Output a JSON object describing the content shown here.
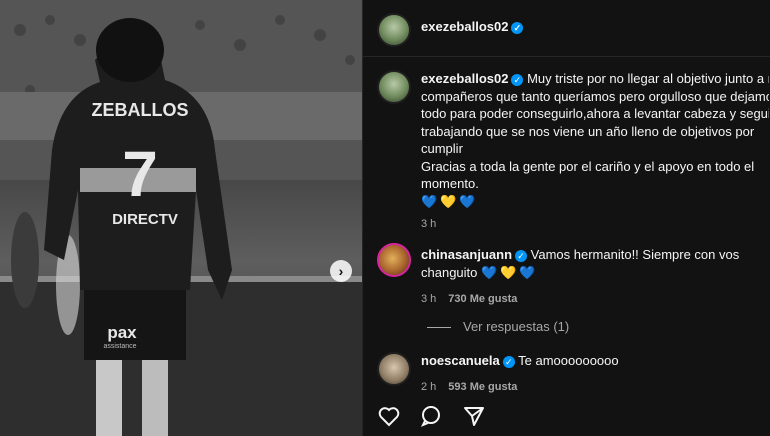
{
  "post": {
    "username": "exezeballos02",
    "jersey_name": "ZEBALLOS",
    "jersey_number": "7",
    "sponsor": "DIRECTV",
    "sponsor2": "pax",
    "sponsor2_sub": "assistance"
  },
  "caption": {
    "username": "exezeballos02",
    "line1": "Muy triste por no llegar al objetivo junto a m",
    "line2": "compañeros que tanto queríamos pero orgulloso que dejamo",
    "line3": "todo para poder conseguirlo,ahora a levantar cabeza y seguir",
    "line4": "trabajando que se nos viene un año lleno de objetivos por",
    "line5": "cumplir",
    "line6": "Gracias a toda la gente por el cariño y el apoyo en todo el",
    "line7": "momento.",
    "hearts": [
      "💙",
      "💛",
      "💙"
    ],
    "time": "3 h"
  },
  "comments": [
    {
      "username": "chinasanjuann",
      "text_line1": "Vamos hermanito!! Siempre con vos",
      "text_line2": "changuito",
      "hearts": [
        "💙",
        "💛",
        "💙"
      ],
      "time": "3 h",
      "likes": "730 Me gusta"
    },
    {
      "username": "noescanuela",
      "text": "Te amooooooooo",
      "time": "2 h",
      "likes": "593 Me gusta"
    }
  ],
  "view_replies": "Ver respuestas (1)",
  "actions": [
    "heart-icon",
    "comment-icon",
    "share-icon"
  ],
  "colors": {
    "verified": "#0095f6",
    "panel_bg": "#121212",
    "story_ring": "#d6249f"
  }
}
